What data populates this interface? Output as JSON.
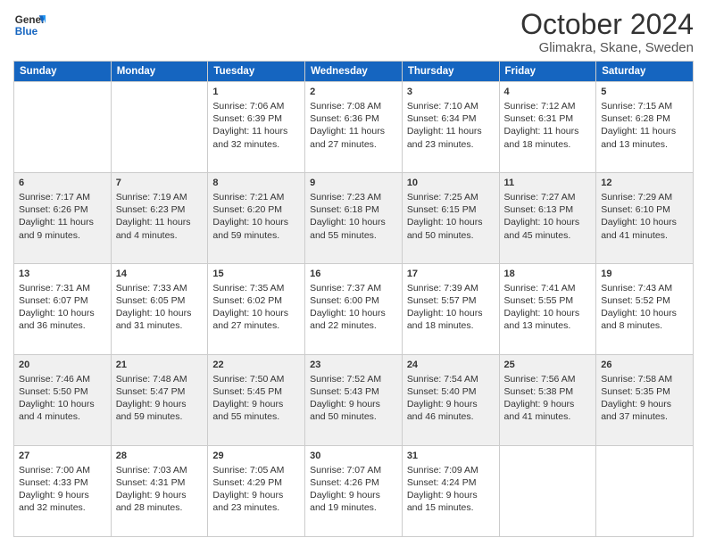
{
  "header": {
    "logo_general": "General",
    "logo_blue": "Blue",
    "title": "October 2024",
    "subtitle": "Glimakra, Skane, Sweden"
  },
  "weekdays": [
    "Sunday",
    "Monday",
    "Tuesday",
    "Wednesday",
    "Thursday",
    "Friday",
    "Saturday"
  ],
  "rows": [
    [
      {
        "day": "",
        "info": ""
      },
      {
        "day": "",
        "info": ""
      },
      {
        "day": "1",
        "info": "Sunrise: 7:06 AM\nSunset: 6:39 PM\nDaylight: 11 hours\nand 32 minutes."
      },
      {
        "day": "2",
        "info": "Sunrise: 7:08 AM\nSunset: 6:36 PM\nDaylight: 11 hours\nand 27 minutes."
      },
      {
        "day": "3",
        "info": "Sunrise: 7:10 AM\nSunset: 6:34 PM\nDaylight: 11 hours\nand 23 minutes."
      },
      {
        "day": "4",
        "info": "Sunrise: 7:12 AM\nSunset: 6:31 PM\nDaylight: 11 hours\nand 18 minutes."
      },
      {
        "day": "5",
        "info": "Sunrise: 7:15 AM\nSunset: 6:28 PM\nDaylight: 11 hours\nand 13 minutes."
      }
    ],
    [
      {
        "day": "6",
        "info": "Sunrise: 7:17 AM\nSunset: 6:26 PM\nDaylight: 11 hours\nand 9 minutes."
      },
      {
        "day": "7",
        "info": "Sunrise: 7:19 AM\nSunset: 6:23 PM\nDaylight: 11 hours\nand 4 minutes."
      },
      {
        "day": "8",
        "info": "Sunrise: 7:21 AM\nSunset: 6:20 PM\nDaylight: 10 hours\nand 59 minutes."
      },
      {
        "day": "9",
        "info": "Sunrise: 7:23 AM\nSunset: 6:18 PM\nDaylight: 10 hours\nand 55 minutes."
      },
      {
        "day": "10",
        "info": "Sunrise: 7:25 AM\nSunset: 6:15 PM\nDaylight: 10 hours\nand 50 minutes."
      },
      {
        "day": "11",
        "info": "Sunrise: 7:27 AM\nSunset: 6:13 PM\nDaylight: 10 hours\nand 45 minutes."
      },
      {
        "day": "12",
        "info": "Sunrise: 7:29 AM\nSunset: 6:10 PM\nDaylight: 10 hours\nand 41 minutes."
      }
    ],
    [
      {
        "day": "13",
        "info": "Sunrise: 7:31 AM\nSunset: 6:07 PM\nDaylight: 10 hours\nand 36 minutes."
      },
      {
        "day": "14",
        "info": "Sunrise: 7:33 AM\nSunset: 6:05 PM\nDaylight: 10 hours\nand 31 minutes."
      },
      {
        "day": "15",
        "info": "Sunrise: 7:35 AM\nSunset: 6:02 PM\nDaylight: 10 hours\nand 27 minutes."
      },
      {
        "day": "16",
        "info": "Sunrise: 7:37 AM\nSunset: 6:00 PM\nDaylight: 10 hours\nand 22 minutes."
      },
      {
        "day": "17",
        "info": "Sunrise: 7:39 AM\nSunset: 5:57 PM\nDaylight: 10 hours\nand 18 minutes."
      },
      {
        "day": "18",
        "info": "Sunrise: 7:41 AM\nSunset: 5:55 PM\nDaylight: 10 hours\nand 13 minutes."
      },
      {
        "day": "19",
        "info": "Sunrise: 7:43 AM\nSunset: 5:52 PM\nDaylight: 10 hours\nand 8 minutes."
      }
    ],
    [
      {
        "day": "20",
        "info": "Sunrise: 7:46 AM\nSunset: 5:50 PM\nDaylight: 10 hours\nand 4 minutes."
      },
      {
        "day": "21",
        "info": "Sunrise: 7:48 AM\nSunset: 5:47 PM\nDaylight: 9 hours\nand 59 minutes."
      },
      {
        "day": "22",
        "info": "Sunrise: 7:50 AM\nSunset: 5:45 PM\nDaylight: 9 hours\nand 55 minutes."
      },
      {
        "day": "23",
        "info": "Sunrise: 7:52 AM\nSunset: 5:43 PM\nDaylight: 9 hours\nand 50 minutes."
      },
      {
        "day": "24",
        "info": "Sunrise: 7:54 AM\nSunset: 5:40 PM\nDaylight: 9 hours\nand 46 minutes."
      },
      {
        "day": "25",
        "info": "Sunrise: 7:56 AM\nSunset: 5:38 PM\nDaylight: 9 hours\nand 41 minutes."
      },
      {
        "day": "26",
        "info": "Sunrise: 7:58 AM\nSunset: 5:35 PM\nDaylight: 9 hours\nand 37 minutes."
      }
    ],
    [
      {
        "day": "27",
        "info": "Sunrise: 7:00 AM\nSunset: 4:33 PM\nDaylight: 9 hours\nand 32 minutes."
      },
      {
        "day": "28",
        "info": "Sunrise: 7:03 AM\nSunset: 4:31 PM\nDaylight: 9 hours\nand 28 minutes."
      },
      {
        "day": "29",
        "info": "Sunrise: 7:05 AM\nSunset: 4:29 PM\nDaylight: 9 hours\nand 23 minutes."
      },
      {
        "day": "30",
        "info": "Sunrise: 7:07 AM\nSunset: 4:26 PM\nDaylight: 9 hours\nand 19 minutes."
      },
      {
        "day": "31",
        "info": "Sunrise: 7:09 AM\nSunset: 4:24 PM\nDaylight: 9 hours\nand 15 minutes."
      },
      {
        "day": "",
        "info": ""
      },
      {
        "day": "",
        "info": ""
      }
    ]
  ]
}
